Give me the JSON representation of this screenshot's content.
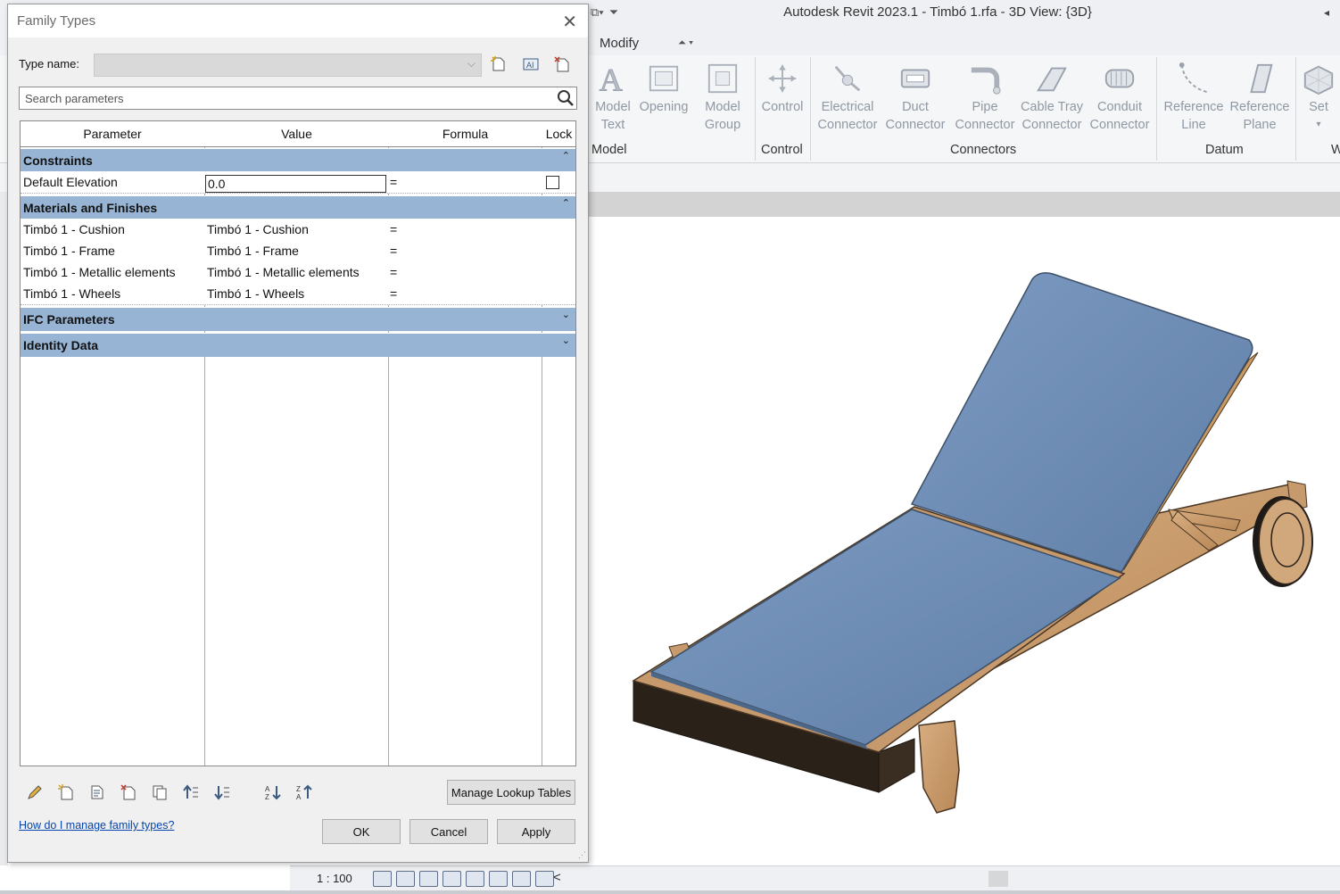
{
  "app": {
    "title": "Autodesk Revit 2023.1 - Timbó 1.rfa - 3D View: {3D}",
    "tab_modify": "Modify",
    "ribbon": {
      "buttons": [
        {
          "line1": "Model",
          "line2": "Text",
          "icon": "model-text-icon"
        },
        {
          "line1": "Opening",
          "line2": "",
          "icon": "opening-icon"
        },
        {
          "line1": "Model",
          "line2": "Group",
          "icon": "model-group-icon"
        },
        {
          "line1": "Control",
          "line2": "",
          "icon": "control-icon"
        },
        {
          "line1": "Electrical",
          "line2": "Connector",
          "icon": "electrical-connector-icon"
        },
        {
          "line1": "Duct",
          "line2": "Connector",
          "icon": "duct-connector-icon"
        },
        {
          "line1": "Pipe",
          "line2": "Connector",
          "icon": "pipe-connector-icon"
        },
        {
          "line1": "Cable Tray",
          "line2": "Connector",
          "icon": "cable-tray-connector-icon"
        },
        {
          "line1": "Conduit",
          "line2": "Connector",
          "icon": "conduit-connector-icon"
        },
        {
          "line1": "Reference",
          "line2": "Line",
          "icon": "reference-line-icon"
        },
        {
          "line1": "Reference",
          "line2": "Plane",
          "icon": "reference-plane-icon"
        },
        {
          "line1": "Set",
          "line2": "",
          "icon": "set-workplane-icon"
        }
      ],
      "panels": [
        "Model",
        "Control",
        "Connectors",
        "Datum",
        "W"
      ]
    },
    "status": {
      "scale": "1 : 100"
    }
  },
  "dialog": {
    "title": "Family Types",
    "type_name_label": "Type name:",
    "type_name_value": "",
    "search_placeholder": "Search parameters",
    "columns": [
      "Parameter",
      "Value",
      "Formula",
      "Lock"
    ],
    "groups": [
      {
        "name": "Constraints",
        "rows": [
          {
            "parameter": "Default Elevation",
            "value": "0.0",
            "formula": "=",
            "lock": false
          }
        ]
      },
      {
        "name": "Materials and Finishes",
        "rows": [
          {
            "parameter": "Timbó 1 - Cushion",
            "value": "Timbó 1 - Cushion",
            "formula": "="
          },
          {
            "parameter": "Timbó 1 - Frame",
            "value": "Timbó 1 - Frame",
            "formula": "="
          },
          {
            "parameter": "Timbó 1 - Metallic elements",
            "value": "Timbó 1 - Metallic elements",
            "formula": "="
          },
          {
            "parameter": "Timbó 1 - Wheels",
            "value": "Timbó 1 - Wheels",
            "formula": "="
          }
        ]
      },
      {
        "name": "IFC Parameters",
        "rows": []
      },
      {
        "name": "Identity Data",
        "rows": []
      }
    ],
    "manage_lookup_label": "Manage Lookup Tables",
    "help_link": "How do I manage family types?",
    "ok_label": "OK",
    "cancel_label": "Cancel",
    "apply_label": "Apply"
  }
}
